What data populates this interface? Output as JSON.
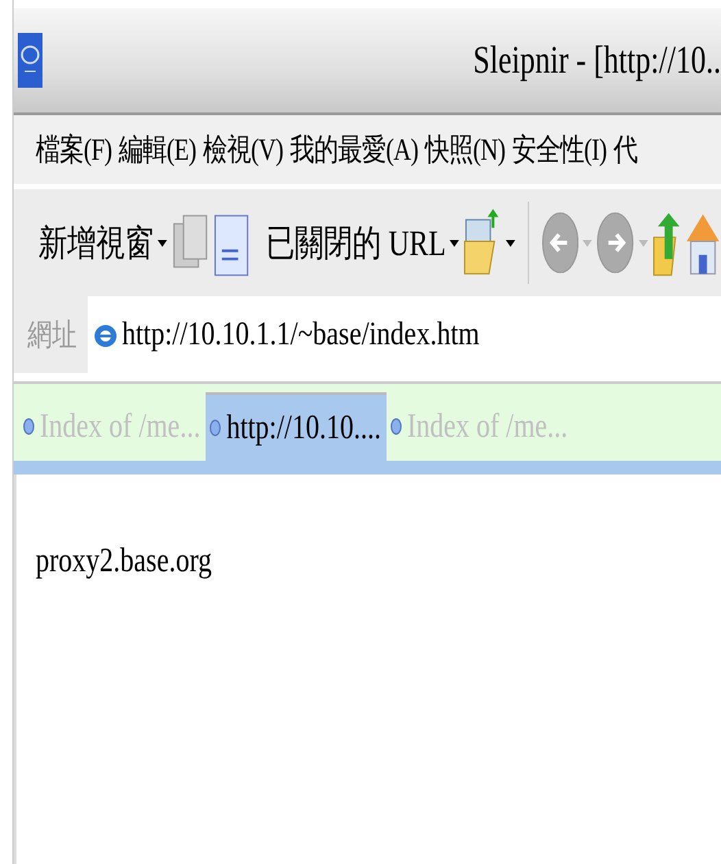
{
  "window": {
    "title": "Sleipnir - [http://10.."
  },
  "menu": [
    "檔案(F)",
    "編輯(E)",
    "檢視(V)",
    "我的最愛(A)",
    "快照(N)",
    "安全性(I)",
    "代"
  ],
  "toolbar": {
    "new_window": "新增視窗",
    "closed_url": "已關閉的 URL"
  },
  "address": {
    "label": "網址",
    "value": "http://10.10.1.1/~base/index.htm"
  },
  "tabs": [
    {
      "label": "Index of /me...",
      "selected": false
    },
    {
      "label": "http://10.10....",
      "selected": true
    },
    {
      "label": "Index of /me...",
      "selected": false
    }
  ],
  "content": {
    "text": "proxy2.base.org"
  }
}
